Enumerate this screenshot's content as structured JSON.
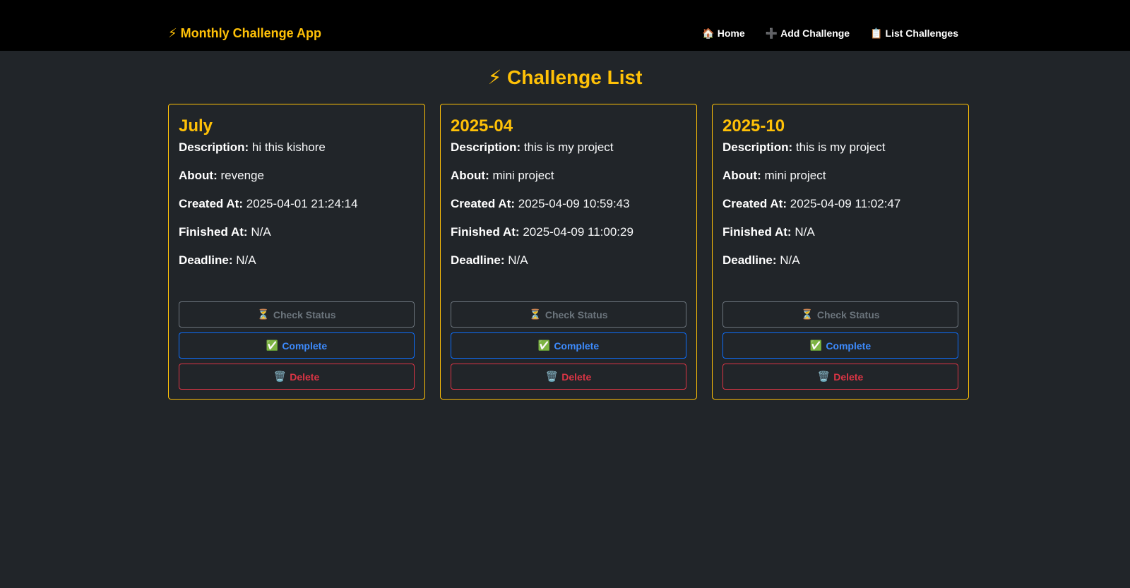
{
  "navbar": {
    "brand_icon": "⚡",
    "brand_text": "Monthly Challenge App",
    "links": [
      {
        "icon": "🏠",
        "label": "Home"
      },
      {
        "icon": "➕",
        "label": "Add Challenge"
      },
      {
        "icon": "📋",
        "label": "List Challenges"
      }
    ]
  },
  "page": {
    "title": "⚡ Challenge List"
  },
  "labels": {
    "description": "Description:",
    "about": "About:",
    "created_at": "Created At:",
    "finished_at": "Finished At:",
    "deadline": "Deadline:"
  },
  "buttons": {
    "check_status_icon": "⏳",
    "check_status": "Check Status",
    "complete_icon": "✅",
    "complete": "Complete",
    "delete_icon": "🗑️",
    "delete": "Delete"
  },
  "challenges": [
    {
      "title": "July",
      "description": "hi this kishore",
      "about": "revenge",
      "created_at": "2025-04-01 21:24:14",
      "finished_at": "N/A",
      "deadline": "N/A"
    },
    {
      "title": "2025-04",
      "description": "this is my project",
      "about": "mini project",
      "created_at": "2025-04-09 10:59:43",
      "finished_at": "2025-04-09 11:00:29",
      "deadline": "N/A"
    },
    {
      "title": "2025-10",
      "description": "this is my project",
      "about": "mini project",
      "created_at": "2025-04-09 11:02:47",
      "finished_at": "N/A",
      "deadline": "N/A"
    }
  ],
  "colors": {
    "accent": "#ffc107",
    "background": "#212529",
    "navbar": "#000000",
    "secondary": "#6c757d",
    "primary": "#0d6efd",
    "danger": "#dc3545"
  }
}
